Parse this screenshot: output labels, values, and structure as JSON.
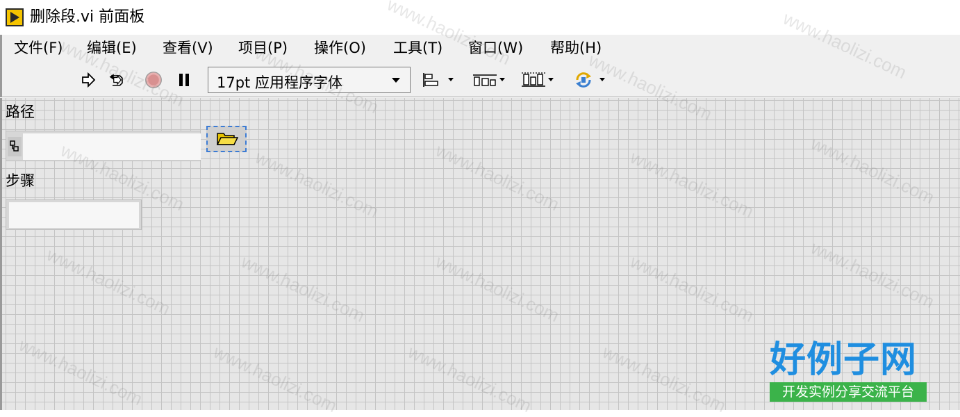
{
  "window": {
    "title": "删除段.vi 前面板"
  },
  "menu": {
    "items": [
      {
        "label": "文件(F)"
      },
      {
        "label": "编辑(E)"
      },
      {
        "label": "查看(V)"
      },
      {
        "label": "项目(P)"
      },
      {
        "label": "操作(O)"
      },
      {
        "label": "工具(T)"
      },
      {
        "label": "窗口(W)"
      },
      {
        "label": "帮助(H)"
      }
    ]
  },
  "toolbar": {
    "font_select_value": "17pt 应用程序字体",
    "icons": [
      "run-arrow-icon",
      "run-continuous-icon",
      "abort-stop-icon",
      "pause-icon",
      "align-objects-icon",
      "distribute-objects-icon",
      "resize-objects-icon",
      "reorder-icon"
    ]
  },
  "panel": {
    "path_label": "路径",
    "path_value": "",
    "step_label": "步骤",
    "step_value": "",
    "grid_color": "#c4c4c4",
    "background_color": "#e6e6e6"
  },
  "watermark": {
    "text": "www.haolizi.com",
    "logo_title": "好例子网",
    "logo_subtitle": "开发实例分享交流平台"
  }
}
